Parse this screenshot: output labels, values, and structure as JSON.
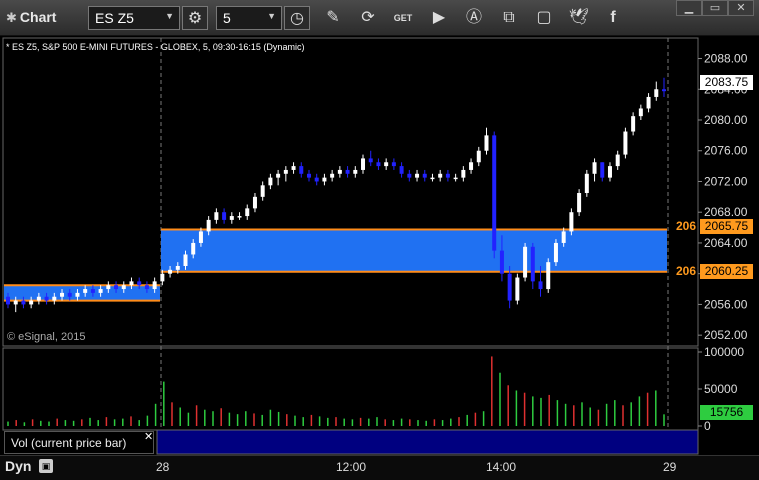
{
  "window": {
    "title": "Chart"
  },
  "toolbar": {
    "symbol": "ES Z5",
    "interval": "5"
  },
  "chart": {
    "header": "* ES Z5, S&P 500 E-MINI FUTURES - GLOBEX, 5, 09:30-16:15 (Dynamic)",
    "watermark": "© eSignal, 2015",
    "price_axis": [
      "2088.00",
      "2084.00",
      "2080.00",
      "2076.00",
      "2072.00",
      "2068.00",
      "2064.00",
      "2060.00",
      "2056.00",
      "2052.00"
    ],
    "last_price": "2083.75",
    "zone_upper_label": "2065.75",
    "zone_lower_label": "2060.25",
    "zone_left_label_upper": "206",
    "zone_left_label_lower": "206",
    "time_labels": [
      "28",
      "12:00",
      "14:00",
      "29"
    ],
    "colors": {
      "up": "#ffffff",
      "down": "#2222ff",
      "zone": "#2277ff",
      "zone_border": "#ff8c1a",
      "tag_price": "#ffffff",
      "tag_zone": "#ff9a1e"
    }
  },
  "volume": {
    "label": "Vol (current price bar)",
    "axis": [
      "100000",
      "50000",
      "0"
    ],
    "current_value": "15756",
    "colors": {
      "up": "#2ecc40",
      "down": "#e03030",
      "tag": "#2ecc40"
    }
  },
  "footer": {
    "mode": "Dyn"
  },
  "chart_data": {
    "type": "candlestick",
    "symbol": "ES Z5",
    "ylim": [
      2051.5,
      2089.5
    ],
    "zones": [
      {
        "from": 2060.25,
        "to": 2065.75,
        "start_bar": 35,
        "end_bar": 160
      },
      {
        "from": 2056.5,
        "to": 2058.5,
        "start_bar": 0,
        "end_bar": 34
      }
    ],
    "candles": [
      [
        2057.0,
        2057.5,
        2055.5,
        2056.0
      ],
      [
        2056.0,
        2057.0,
        2055.0,
        2056.5
      ],
      [
        2056.5,
        2057.0,
        2055.5,
        2056.0
      ],
      [
        2056.0,
        2057.0,
        2055.5,
        2056.5
      ],
      [
        2056.5,
        2057.5,
        2056.0,
        2057.0
      ],
      [
        2057.0,
        2057.5,
        2056.0,
        2056.5
      ],
      [
        2056.5,
        2057.5,
        2056.0,
        2057.0
      ],
      [
        2057.0,
        2058.0,
        2056.5,
        2057.5
      ],
      [
        2057.5,
        2058.0,
        2056.5,
        2057.0
      ],
      [
        2057.0,
        2058.0,
        2056.5,
        2057.5
      ],
      [
        2057.5,
        2058.5,
        2057.0,
        2058.0
      ],
      [
        2058.0,
        2058.5,
        2057.0,
        2057.5
      ],
      [
        2057.5,
        2058.5,
        2057.0,
        2058.0
      ],
      [
        2058.0,
        2059.0,
        2057.5,
        2058.5
      ],
      [
        2058.5,
        2059.0,
        2057.5,
        2058.0
      ],
      [
        2058.0,
        2059.0,
        2057.5,
        2058.5
      ],
      [
        2058.5,
        2059.5,
        2058.0,
        2059.0
      ],
      [
        2059.0,
        2059.5,
        2058.0,
        2058.5
      ],
      [
        2058.5,
        2059.0,
        2057.5,
        2058.0
      ],
      [
        2058.0,
        2059.5,
        2057.5,
        2059.0
      ],
      [
        2059.0,
        2060.5,
        2058.5,
        2060.0
      ],
      [
        2060.0,
        2061.0,
        2059.5,
        2060.5
      ],
      [
        2060.5,
        2061.5,
        2060.0,
        2061.0
      ],
      [
        2061.0,
        2063.0,
        2060.5,
        2062.5
      ],
      [
        2062.5,
        2064.5,
        2062.0,
        2064.0
      ],
      [
        2064.0,
        2066.0,
        2063.5,
        2065.5
      ],
      [
        2065.5,
        2067.5,
        2065.0,
        2067.0
      ],
      [
        2067.0,
        2068.5,
        2066.5,
        2068.0
      ],
      [
        2068.0,
        2068.5,
        2066.5,
        2067.0
      ],
      [
        2067.0,
        2068.0,
        2066.5,
        2067.5
      ],
      [
        2067.5,
        2068.0,
        2067.0,
        2067.5
      ],
      [
        2067.5,
        2069.0,
        2067.0,
        2068.5
      ],
      [
        2068.5,
        2070.5,
        2068.0,
        2070.0
      ],
      [
        2070.0,
        2072.0,
        2069.5,
        2071.5
      ],
      [
        2071.5,
        2073.0,
        2071.0,
        2072.5
      ],
      [
        2072.5,
        2073.5,
        2071.5,
        2073.0
      ],
      [
        2073.0,
        2074.0,
        2072.0,
        2073.5
      ],
      [
        2073.5,
        2074.5,
        2073.0,
        2074.0
      ],
      [
        2074.0,
        2074.5,
        2072.5,
        2073.0
      ],
      [
        2073.0,
        2073.5,
        2072.0,
        2072.5
      ],
      [
        2072.5,
        2073.0,
        2071.5,
        2072.0
      ],
      [
        2072.0,
        2073.0,
        2071.5,
        2072.5
      ],
      [
        2072.5,
        2073.5,
        2072.0,
        2073.0
      ],
      [
        2073.0,
        2074.0,
        2072.5,
        2073.5
      ],
      [
        2073.5,
        2074.0,
        2072.5,
        2073.0
      ],
      [
        2073.0,
        2074.0,
        2072.5,
        2073.5
      ],
      [
        2073.5,
        2075.5,
        2073.0,
        2075.0
      ],
      [
        2075.0,
        2076.0,
        2074.0,
        2074.5
      ],
      [
        2074.5,
        2075.0,
        2073.5,
        2074.0
      ],
      [
        2074.0,
        2075.0,
        2073.5,
        2074.5
      ],
      [
        2074.5,
        2075.0,
        2073.5,
        2074.0
      ],
      [
        2074.0,
        2074.5,
        2072.5,
        2073.0
      ],
      [
        2073.0,
        2073.5,
        2072.0,
        2072.5
      ],
      [
        2072.5,
        2073.5,
        2072.0,
        2073.0
      ],
      [
        2073.0,
        2073.5,
        2072.0,
        2072.5
      ],
      [
        2072.5,
        2073.0,
        2072.0,
        2072.5
      ],
      [
        2072.5,
        2073.5,
        2072.0,
        2073.0
      ],
      [
        2073.0,
        2073.5,
        2072.0,
        2072.5
      ],
      [
        2072.5,
        2073.0,
        2072.0,
        2072.5
      ],
      [
        2072.5,
        2074.0,
        2072.0,
        2073.5
      ],
      [
        2073.5,
        2075.0,
        2073.0,
        2074.5
      ],
      [
        2074.5,
        2076.5,
        2074.0,
        2076.0
      ],
      [
        2076.0,
        2079.0,
        2075.5,
        2078.0
      ],
      [
        2078.0,
        2078.5,
        2062.0,
        2063.0
      ],
      [
        2063.0,
        2065.0,
        2059.0,
        2060.0
      ],
      [
        2060.0,
        2061.0,
        2055.5,
        2056.5
      ],
      [
        2056.5,
        2060.0,
        2056.0,
        2059.5
      ],
      [
        2059.5,
        2064.0,
        2059.0,
        2063.5
      ],
      [
        2063.5,
        2064.0,
        2058.0,
        2059.0
      ],
      [
        2059.0,
        2061.0,
        2057.0,
        2058.0
      ],
      [
        2058.0,
        2062.0,
        2057.5,
        2061.5
      ],
      [
        2061.5,
        2064.5,
        2061.0,
        2064.0
      ],
      [
        2064.0,
        2066.0,
        2063.5,
        2065.5
      ],
      [
        2065.5,
        2068.5,
        2065.0,
        2068.0
      ],
      [
        2068.0,
        2071.0,
        2067.5,
        2070.5
      ],
      [
        2070.5,
        2073.5,
        2070.0,
        2073.0
      ],
      [
        2073.0,
        2075.0,
        2072.0,
        2074.5
      ],
      [
        2074.5,
        2074.5,
        2072.0,
        2072.5
      ],
      [
        2072.5,
        2074.5,
        2072.0,
        2074.0
      ],
      [
        2074.0,
        2076.0,
        2073.5,
        2075.5
      ],
      [
        2075.5,
        2079.0,
        2075.0,
        2078.5
      ],
      [
        2078.5,
        2081.0,
        2078.0,
        2080.5
      ],
      [
        2080.5,
        2082.0,
        2080.0,
        2081.5
      ],
      [
        2081.5,
        2083.5,
        2081.0,
        2083.0
      ],
      [
        2083.0,
        2085.0,
        2082.5,
        2084.0
      ],
      [
        2084.0,
        2085.5,
        2083.0,
        2083.75
      ]
    ],
    "volumes": [
      [
        6000,
        1
      ],
      [
        8000,
        0
      ],
      [
        5000,
        1
      ],
      [
        9000,
        0
      ],
      [
        7000,
        1
      ],
      [
        6000,
        1
      ],
      [
        10000,
        0
      ],
      [
        8000,
        1
      ],
      [
        7000,
        1
      ],
      [
        9000,
        0
      ],
      [
        11000,
        1
      ],
      [
        8000,
        1
      ],
      [
        12000,
        0
      ],
      [
        9000,
        1
      ],
      [
        10000,
        1
      ],
      [
        13000,
        0
      ],
      [
        8000,
        1
      ],
      [
        14000,
        1
      ],
      [
        30000,
        1
      ],
      [
        60000,
        1
      ],
      [
        32000,
        0
      ],
      [
        25000,
        1
      ],
      [
        18000,
        1
      ],
      [
        28000,
        0
      ],
      [
        22000,
        1
      ],
      [
        20000,
        1
      ],
      [
        24000,
        0
      ],
      [
        18000,
        1
      ],
      [
        16000,
        1
      ],
      [
        20000,
        1
      ],
      [
        17000,
        0
      ],
      [
        15000,
        1
      ],
      [
        22000,
        1
      ],
      [
        19000,
        1
      ],
      [
        16000,
        0
      ],
      [
        14000,
        1
      ],
      [
        12000,
        1
      ],
      [
        15000,
        0
      ],
      [
        13000,
        1
      ],
      [
        11000,
        1
      ],
      [
        12000,
        0
      ],
      [
        10000,
        1
      ],
      [
        9000,
        1
      ],
      [
        11000,
        0
      ],
      [
        10000,
        1
      ],
      [
        12000,
        1
      ],
      [
        9000,
        0
      ],
      [
        8000,
        1
      ],
      [
        10000,
        1
      ],
      [
        9000,
        0
      ],
      [
        8000,
        1
      ],
      [
        7000,
        1
      ],
      [
        9000,
        0
      ],
      [
        8000,
        1
      ],
      [
        10000,
        1
      ],
      [
        12000,
        0
      ],
      [
        15000,
        1
      ],
      [
        18000,
        0
      ],
      [
        20000,
        1
      ],
      [
        94000,
        0
      ],
      [
        72000,
        1
      ],
      [
        55000,
        0
      ],
      [
        48000,
        1
      ],
      [
        45000,
        0
      ],
      [
        40000,
        1
      ],
      [
        38000,
        1
      ],
      [
        42000,
        0
      ],
      [
        35000,
        1
      ],
      [
        30000,
        1
      ],
      [
        28000,
        0
      ],
      [
        32000,
        1
      ],
      [
        25000,
        1
      ],
      [
        22000,
        0
      ],
      [
        30000,
        1
      ],
      [
        35000,
        1
      ],
      [
        28000,
        0
      ],
      [
        32000,
        1
      ],
      [
        40000,
        1
      ],
      [
        45000,
        0
      ],
      [
        48000,
        1
      ],
      [
        15756,
        1
      ]
    ]
  }
}
